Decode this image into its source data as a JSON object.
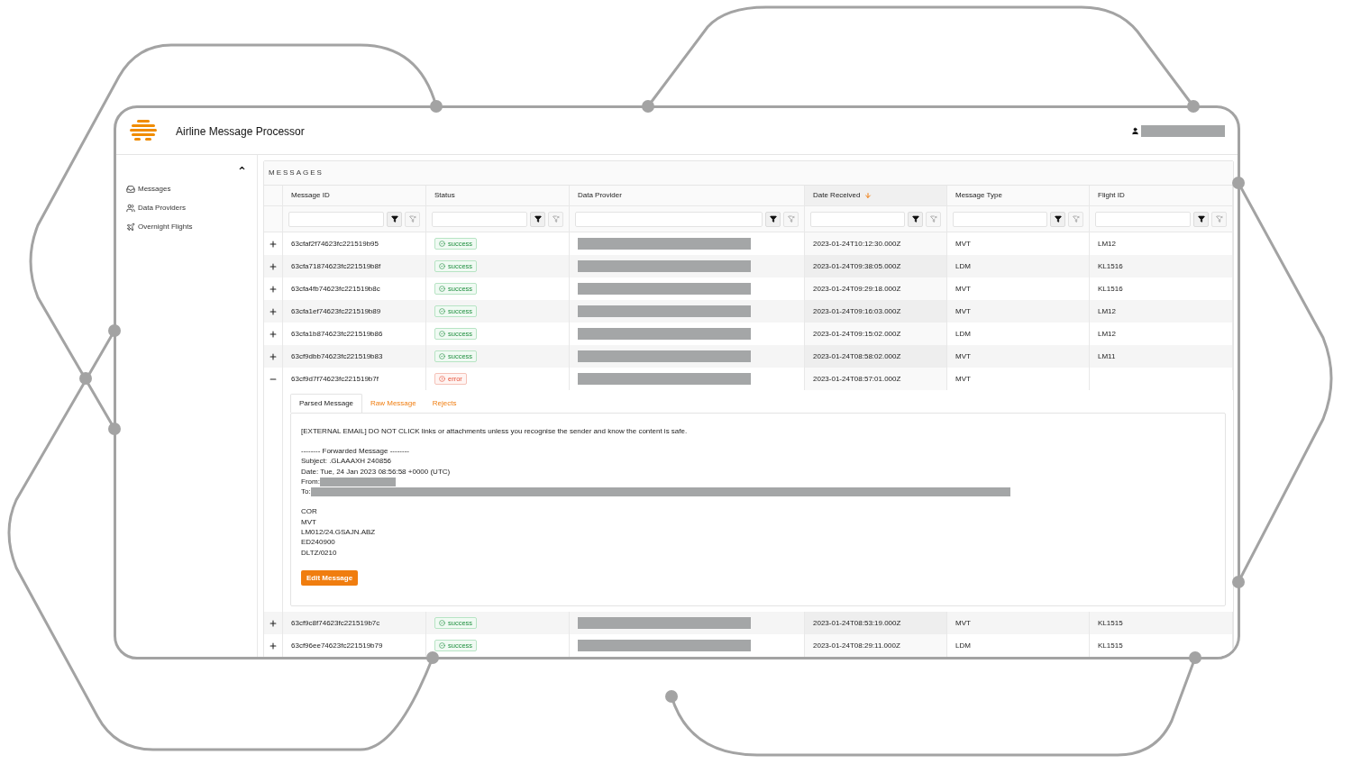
{
  "app": {
    "title": "Airline Message Processor"
  },
  "sidebar": {
    "items": [
      {
        "label": "Messages",
        "kind": "inbox"
      },
      {
        "label": "Data Providers",
        "kind": "users"
      },
      {
        "label": "Overnight Flights",
        "kind": "plane"
      }
    ]
  },
  "panel": {
    "title": "MESSAGES"
  },
  "table": {
    "columns": [
      {
        "label": "Message ID",
        "sorted": false
      },
      {
        "label": "Status",
        "sorted": false
      },
      {
        "label": "Data Provider",
        "sorted": false
      },
      {
        "label": "Date Received",
        "sorted": true
      },
      {
        "label": "Message Type",
        "sorted": false
      },
      {
        "label": "Flight ID",
        "sorted": false
      }
    ],
    "rows": [
      {
        "id": "63cfaf2f74623fc221519b95",
        "status": "success",
        "kind": "success",
        "date": "2023-01-24T10:12:30.000Z",
        "type": "MVT",
        "flight": "LM12",
        "expanded": false
      },
      {
        "id": "63cfa71874623fc221519b8f",
        "status": "success",
        "kind": "success",
        "date": "2023-01-24T09:38:05.000Z",
        "type": "LDM",
        "flight": "KL1516",
        "expanded": false
      },
      {
        "id": "63cfa4fb74623fc221519b8c",
        "status": "success",
        "kind": "success",
        "date": "2023-01-24T09:29:18.000Z",
        "type": "MVT",
        "flight": "KL1516",
        "expanded": false
      },
      {
        "id": "63cfa1ef74623fc221519b89",
        "status": "success",
        "kind": "success",
        "date": "2023-01-24T09:16:03.000Z",
        "type": "MVT",
        "flight": "LM12",
        "expanded": false
      },
      {
        "id": "63cfa1b874623fc221519b86",
        "status": "success",
        "kind": "success",
        "date": "2023-01-24T09:15:02.000Z",
        "type": "LDM",
        "flight": "LM12",
        "expanded": false
      },
      {
        "id": "63cf9dbb74623fc221519b83",
        "status": "success",
        "kind": "success",
        "date": "2023-01-24T08:58:02.000Z",
        "type": "MVT",
        "flight": "LM11",
        "expanded": false
      },
      {
        "id": "63cf9d7f74623fc221519b7f",
        "status": "error",
        "kind": "error",
        "date": "2023-01-24T08:57:01.000Z",
        "type": "MVT",
        "expanded": true
      },
      {
        "id": "63cf9c8f74623fc221519b7c",
        "status": "success",
        "kind": "success",
        "date": "2023-01-24T08:53:19.000Z",
        "type": "MVT",
        "flight": "KL1515",
        "expanded": false
      },
      {
        "id": "63cf96ee74623fc221519b79",
        "status": "success",
        "kind": "success",
        "date": "2023-01-24T08:29:11.000Z",
        "type": "LDM",
        "flight": "KL1515",
        "expanded": false
      }
    ]
  },
  "detail": {
    "tabs": [
      {
        "label": "Parsed Message",
        "selected": true
      },
      {
        "label": "Raw Message",
        "selected": false
      },
      {
        "label": "Rejects",
        "selected": false
      }
    ],
    "paragraphs": [
      [
        {
          "text": "[EXTERNAL EMAIL] DO NOT CLICK links or attachments unless you recognise the sender and know the content is safe."
        }
      ],
      [
        {
          "text": "-------- Forwarded Message --------"
        },
        {
          "text": "Subject: .GLAAAXH 240856"
        },
        {
          "text": "Date: Tue, 24 Jan 2023 08:56:58 +0000 (UTC)"
        },
        {
          "text": "From:",
          "redacted": true,
          "wide": false
        },
        {
          "text": "To:",
          "redacted": true,
          "wide": true
        }
      ],
      [
        {
          "text": "COR"
        },
        {
          "text": "MVT"
        },
        {
          "text": "LM012/24.GSAJN.ABZ"
        },
        {
          "text": "ED240900"
        },
        {
          "text": "DLTZ/0210"
        }
      ]
    ],
    "button": "Edit Message"
  }
}
